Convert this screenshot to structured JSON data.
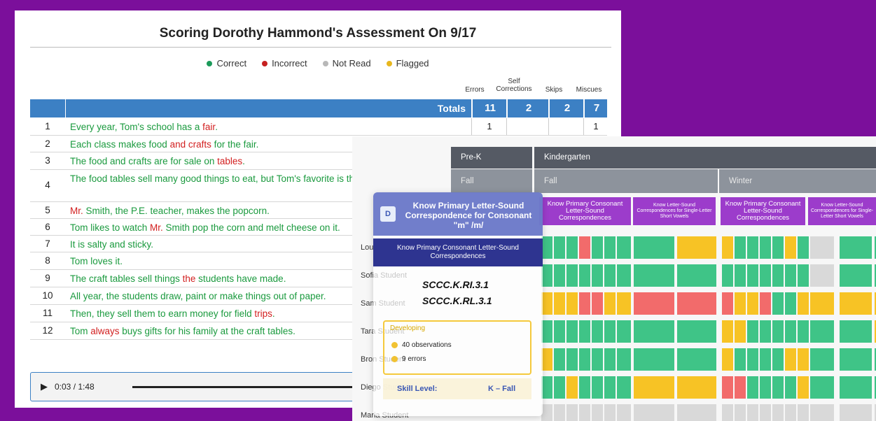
{
  "assessment": {
    "title": "Scoring Dorothy Hammond's Assessment On 9/17",
    "legend": [
      {
        "label": "Correct",
        "color": "#1b9a5a"
      },
      {
        "label": "Incorrect",
        "color": "#c62020"
      },
      {
        "label": "Not Read",
        "color": "#b8b8b8"
      },
      {
        "label": "Flagged",
        "color": "#e8b71e"
      }
    ],
    "columns": {
      "errors": "Errors",
      "self_corrections_1": "Self",
      "self_corrections_2": "Corrections",
      "skips": "Skips",
      "miscues": "Miscues"
    },
    "totals": {
      "label": "Totals",
      "errors": "11",
      "self_corrections": "2",
      "skips": "2",
      "miscues": "7"
    },
    "rows": [
      {
        "num": "1",
        "errors": "1",
        "miscues": "1"
      },
      {
        "num": "2"
      },
      {
        "num": "3"
      },
      {
        "num": "4"
      },
      {
        "num": "5"
      },
      {
        "num": "6"
      },
      {
        "num": "7"
      },
      {
        "num": "8"
      },
      {
        "num": "9"
      },
      {
        "num": "10"
      },
      {
        "num": "11"
      },
      {
        "num": "12"
      }
    ],
    "audio": {
      "time": "0:03 / 1:48"
    }
  },
  "heatmap": {
    "grades": {
      "prek": "Pre-K",
      "k": "Kindergarten"
    },
    "seasons": {
      "prek_fall": "Fall",
      "k_fall": "Fall",
      "k_winter": "Winter"
    },
    "skills": {
      "s1": "Know Primary Consonant Letter-Sound Correspondences",
      "s2": "Know Letter-Sound Correspondences for Single-Letter Short Vowels",
      "s3": "Know Primary Consonant Letter-Sound Correspondences",
      "s4": "Know Letter-Sound Correspondences for Single-Letter Short Vowels"
    },
    "students": [
      "Louis Student",
      "Sofia Student",
      "Sam Student",
      "Tara Student",
      "Bron Student",
      "Diego Student",
      "Maria Student"
    ],
    "colors": {
      "green": "#3fc487",
      "red": "#f26b6b",
      "yellow": "#f7c325",
      "grey": "#d9d9d9"
    }
  },
  "popover": {
    "badge": "D",
    "title": "Know Primary Letter-Sound Correspondence for Consonant \"m\" /m/",
    "subtitle": "Know Primary Consonant Letter-Sound Correspondences",
    "codes": [
      "SCCC.K.RI.3.1",
      "SCCC.K.RL.3.1"
    ],
    "developing_label": "Developing",
    "observations": "40 observations",
    "errors": "9 errors",
    "skill_level_label": "Skill Level:",
    "skill_level_value": "K – Fall"
  }
}
